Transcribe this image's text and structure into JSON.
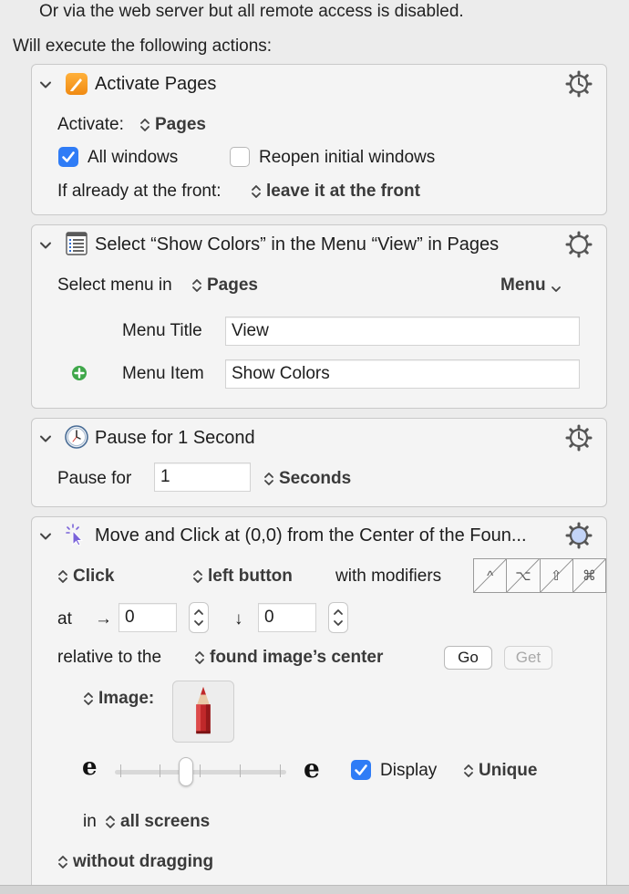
{
  "header": {
    "web_note": "Or via the web server but all remote access is disabled.",
    "actions_heading": "Will execute the following actions:"
  },
  "action1": {
    "title": "Activate Pages",
    "activate_label": "Activate:",
    "app": "Pages",
    "all_windows_label": "All windows",
    "all_windows_checked": true,
    "reopen_label": "Reopen initial windows",
    "reopen_checked": false,
    "front_label": "If already at the front:",
    "front_option": "leave it at the front"
  },
  "action2": {
    "title": "Select “Show Colors” in the Menu “View” in Pages",
    "select_menu_label": "Select menu in",
    "app": "Pages",
    "menu_popup": "Menu",
    "menu_title_label": "Menu Title",
    "menu_title_value": "View",
    "menu_item_label": "Menu Item",
    "menu_item_value": "Show Colors"
  },
  "action3": {
    "title": "Pause for 1 Second",
    "pause_label": "Pause for",
    "pause_value": "1",
    "unit": "Seconds"
  },
  "action4": {
    "title": "Move and Click at (0,0) from the Center of the Foun...",
    "click_mode": "Click",
    "button": "left button",
    "modifiers_label": "with modifiers",
    "modifiers": [
      "^",
      "⌥",
      "⇧",
      "⌘"
    ],
    "at_label": "at",
    "x_arrow": "→",
    "x_value": "0",
    "y_arrow": "↓",
    "y_value": "0",
    "relative_label": "relative to the",
    "relative_option": "found image’s center",
    "go_label": "Go",
    "get_label": "Get",
    "image_label": "Image:",
    "fuzz_low": "e",
    "fuzz_high": "e",
    "display_label": "Display",
    "display_checked": true,
    "unique_option": "Unique",
    "in_label": "in",
    "screens_option": "all screens",
    "drag_option": "without dragging"
  },
  "colors": {
    "accent": "#2f7cf6",
    "background": "#ececec",
    "panel": "#f4f4f4"
  },
  "icons": {
    "chevron": "chevron-down-icon",
    "gear": "gear-icon",
    "pages_app": "pages-app-icon",
    "menu": "menu-list-icon",
    "pause": "clock-icon",
    "click": "cursor-click-icon",
    "add": "plus-circle-icon",
    "pencil": "pencil-image-icon"
  }
}
